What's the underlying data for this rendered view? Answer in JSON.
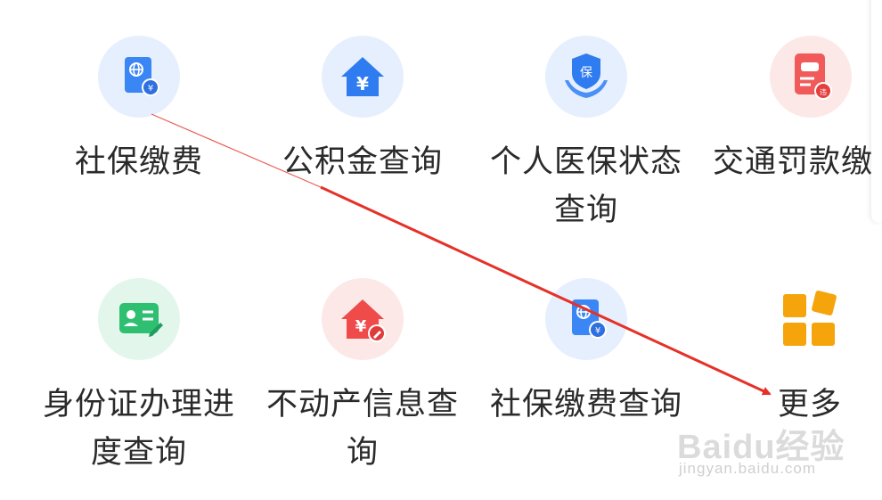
{
  "services": {
    "row1": [
      {
        "label": "社保缴费",
        "icon": "passport-yuan-icon"
      },
      {
        "label": "公积金查询",
        "icon": "house-yuan-icon"
      },
      {
        "label": "个人医保状态查询",
        "icon": "shield-hands-icon"
      },
      {
        "label": "交通罚款缴",
        "icon": "car-ticket-icon"
      }
    ],
    "row2": [
      {
        "label": "身份证办理进度查询",
        "icon": "id-card-icon"
      },
      {
        "label": "不动产信息查询",
        "icon": "house-yuan-edit-icon"
      },
      {
        "label": "社保缴费查询",
        "icon": "passport-yuan-icon"
      },
      {
        "label": "更多",
        "icon": "more-grid-icon"
      }
    ]
  },
  "watermark": {
    "brand": "Baidu经验",
    "url": "jingyan.baidu.com"
  },
  "colors": {
    "accent_blue": "#2f7bf0",
    "accent_red": "#f04b4b",
    "accent_green": "#2fbf71",
    "accent_orange": "#f5a40c",
    "arrow_red": "#e53228"
  }
}
